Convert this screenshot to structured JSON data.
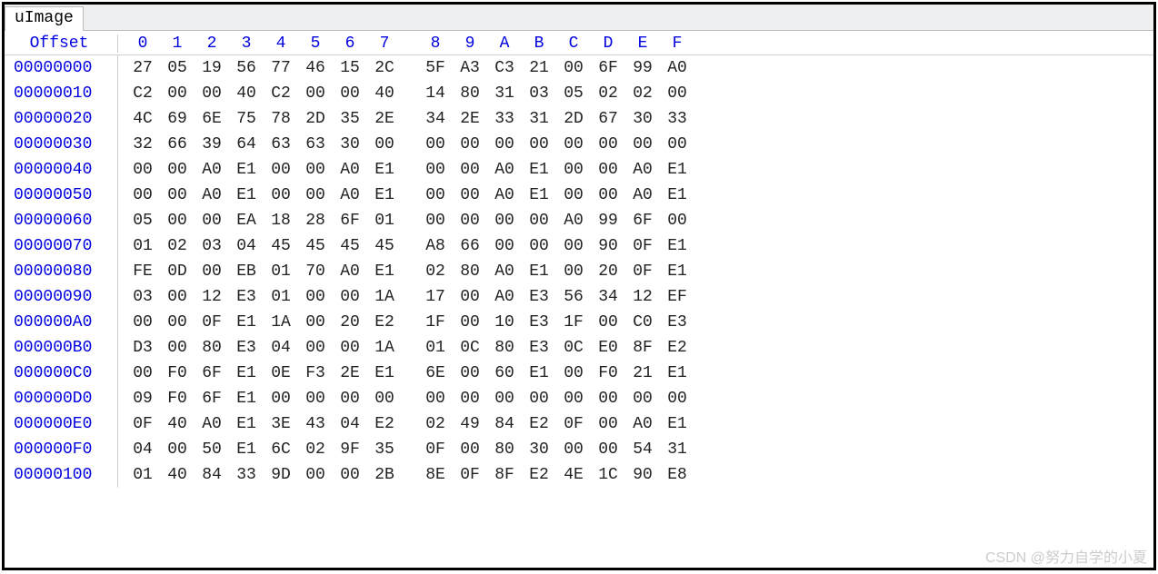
{
  "tab": {
    "label": "uImage"
  },
  "header": {
    "offset_label": "Offset",
    "columns": [
      "0",
      "1",
      "2",
      "3",
      "4",
      "5",
      "6",
      "7",
      "8",
      "9",
      "A",
      "B",
      "C",
      "D",
      "E",
      "F"
    ]
  },
  "rows": [
    {
      "offset": "00000000",
      "bytes": [
        "27",
        "05",
        "19",
        "56",
        "77",
        "46",
        "15",
        "2C",
        "5F",
        "A3",
        "C3",
        "21",
        "00",
        "6F",
        "99",
        "A0"
      ]
    },
    {
      "offset": "00000010",
      "bytes": [
        "C2",
        "00",
        "00",
        "40",
        "C2",
        "00",
        "00",
        "40",
        "14",
        "80",
        "31",
        "03",
        "05",
        "02",
        "02",
        "00"
      ]
    },
    {
      "offset": "00000020",
      "bytes": [
        "4C",
        "69",
        "6E",
        "75",
        "78",
        "2D",
        "35",
        "2E",
        "34",
        "2E",
        "33",
        "31",
        "2D",
        "67",
        "30",
        "33"
      ]
    },
    {
      "offset": "00000030",
      "bytes": [
        "32",
        "66",
        "39",
        "64",
        "63",
        "63",
        "30",
        "00",
        "00",
        "00",
        "00",
        "00",
        "00",
        "00",
        "00",
        "00"
      ]
    },
    {
      "offset": "00000040",
      "bytes": [
        "00",
        "00",
        "A0",
        "E1",
        "00",
        "00",
        "A0",
        "E1",
        "00",
        "00",
        "A0",
        "E1",
        "00",
        "00",
        "A0",
        "E1"
      ]
    },
    {
      "offset": "00000050",
      "bytes": [
        "00",
        "00",
        "A0",
        "E1",
        "00",
        "00",
        "A0",
        "E1",
        "00",
        "00",
        "A0",
        "E1",
        "00",
        "00",
        "A0",
        "E1"
      ]
    },
    {
      "offset": "00000060",
      "bytes": [
        "05",
        "00",
        "00",
        "EA",
        "18",
        "28",
        "6F",
        "01",
        "00",
        "00",
        "00",
        "00",
        "A0",
        "99",
        "6F",
        "00"
      ]
    },
    {
      "offset": "00000070",
      "bytes": [
        "01",
        "02",
        "03",
        "04",
        "45",
        "45",
        "45",
        "45",
        "A8",
        "66",
        "00",
        "00",
        "00",
        "90",
        "0F",
        "E1"
      ]
    },
    {
      "offset": "00000080",
      "bytes": [
        "FE",
        "0D",
        "00",
        "EB",
        "01",
        "70",
        "A0",
        "E1",
        "02",
        "80",
        "A0",
        "E1",
        "00",
        "20",
        "0F",
        "E1"
      ]
    },
    {
      "offset": "00000090",
      "bytes": [
        "03",
        "00",
        "12",
        "E3",
        "01",
        "00",
        "00",
        "1A",
        "17",
        "00",
        "A0",
        "E3",
        "56",
        "34",
        "12",
        "EF"
      ]
    },
    {
      "offset": "000000A0",
      "bytes": [
        "00",
        "00",
        "0F",
        "E1",
        "1A",
        "00",
        "20",
        "E2",
        "1F",
        "00",
        "10",
        "E3",
        "1F",
        "00",
        "C0",
        "E3"
      ]
    },
    {
      "offset": "000000B0",
      "bytes": [
        "D3",
        "00",
        "80",
        "E3",
        "04",
        "00",
        "00",
        "1A",
        "01",
        "0C",
        "80",
        "E3",
        "0C",
        "E0",
        "8F",
        "E2"
      ]
    },
    {
      "offset": "000000C0",
      "bytes": [
        "00",
        "F0",
        "6F",
        "E1",
        "0E",
        "F3",
        "2E",
        "E1",
        "6E",
        "00",
        "60",
        "E1",
        "00",
        "F0",
        "21",
        "E1"
      ]
    },
    {
      "offset": "000000D0",
      "bytes": [
        "09",
        "F0",
        "6F",
        "E1",
        "00",
        "00",
        "00",
        "00",
        "00",
        "00",
        "00",
        "00",
        "00",
        "00",
        "00",
        "00"
      ]
    },
    {
      "offset": "000000E0",
      "bytes": [
        "0F",
        "40",
        "A0",
        "E1",
        "3E",
        "43",
        "04",
        "E2",
        "02",
        "49",
        "84",
        "E2",
        "0F",
        "00",
        "A0",
        "E1"
      ]
    },
    {
      "offset": "000000F0",
      "bytes": [
        "04",
        "00",
        "50",
        "E1",
        "6C",
        "02",
        "9F",
        "35",
        "0F",
        "00",
        "80",
        "30",
        "00",
        "00",
        "54",
        "31"
      ]
    },
    {
      "offset": "00000100",
      "bytes": [
        "01",
        "40",
        "84",
        "33",
        "9D",
        "00",
        "00",
        "2B",
        "8E",
        "0F",
        "8F",
        "E2",
        "4E",
        "1C",
        "90",
        "E8"
      ]
    }
  ],
  "watermark": "CSDN @努力自学的小夏"
}
